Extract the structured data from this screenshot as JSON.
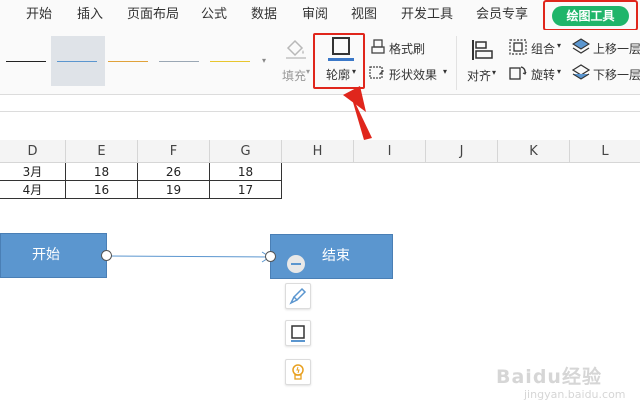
{
  "menu": {
    "tabs": [
      "开始",
      "插入",
      "页面布局",
      "公式",
      "数据",
      "审阅",
      "视图",
      "开发工具",
      "会员专享"
    ],
    "active_tab": "绘图工具",
    "active_color": "#1fb56a"
  },
  "ribbon": {
    "outline_style_colors": [
      "#222222",
      "#5b96cf",
      "#e0a23a",
      "#9aa7b4",
      "#e8c62e"
    ],
    "fill_label": "填充",
    "outline_label": "轮廓",
    "format_painter_label": "格式刷",
    "shape_effects_label": "形状效果",
    "align_label": "对齐",
    "group_label": "组合",
    "rotate_label": "旋转",
    "bring_forward_label": "上移一层",
    "send_backward_label": "下移一层"
  },
  "sheet": {
    "columns": [
      "D",
      "E",
      "F",
      "G",
      "H",
      "I",
      "J",
      "K",
      "L"
    ],
    "rows": [
      [
        "3月",
        "18",
        "26",
        "18"
      ],
      [
        "4月",
        "16",
        "19",
        "17"
      ]
    ]
  },
  "shapes": {
    "start_label": "开始",
    "end_label": "结束",
    "fill_color": "#5b96cf"
  },
  "float_toolbar": [
    "brush-icon",
    "outline-icon",
    "bulb-icon"
  ],
  "annotation_color": "#e0261c",
  "watermark": {
    "text": "Baidu经验",
    "sub": "jingyan.baidu.com"
  }
}
